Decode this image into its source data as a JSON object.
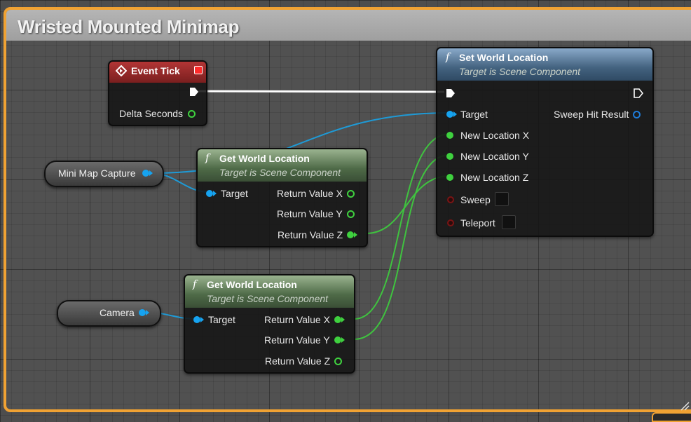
{
  "comment": {
    "title": "Wristed Mounted Minimap"
  },
  "colors": {
    "comment_border": "#f0a233",
    "object_pin": "#16a3f0",
    "float_pin": "#3fd13f",
    "exec_wire": "#ffffff"
  },
  "event_tick": {
    "title": "Event Tick",
    "delta_seconds": "Delta Seconds"
  },
  "set_world_location": {
    "title": "Set World Location",
    "subtitle": "Target is Scene Component",
    "target": "Target",
    "sweep_hit_result": "Sweep Hit Result",
    "new_location_x": "New Location X",
    "new_location_y": "New Location Y",
    "new_location_z": "New Location Z",
    "sweep": "Sweep",
    "teleport": "Teleport"
  },
  "get_world_location_1": {
    "title": "Get World Location",
    "subtitle": "Target is Scene Component",
    "target": "Target",
    "return_x": "Return Value X",
    "return_y": "Return Value Y",
    "return_z": "Return Value Z"
  },
  "get_world_location_2": {
    "title": "Get World Location",
    "subtitle": "Target is Scene Component",
    "target": "Target",
    "return_x": "Return Value X",
    "return_y": "Return Value Y",
    "return_z": "Return Value Z"
  },
  "variables": {
    "mini_map_capture": "Mini Map Capture",
    "camera": "Camera"
  },
  "icons": {
    "event": "event-diamond-icon",
    "function": "function-f-icon",
    "exec": "exec-arrow-icon"
  }
}
